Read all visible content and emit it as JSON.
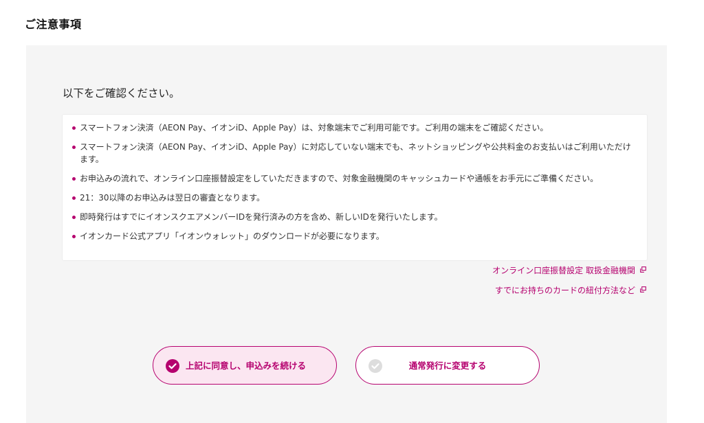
{
  "page": {
    "heading": "ご注意事項"
  },
  "notice": {
    "intro": "以下をご確認ください。",
    "items": [
      "スマートフォン決済（AEON Pay、イオンiD、Apple Pay）は、対象端末でご利用可能です。ご利用の端末をご確認ください。",
      "スマートフォン決済（AEON Pay、イオンiD、Apple Pay）に対応していない端末でも、ネットショッピングや公共料金のお支払いはご利用いただけます。",
      "お申込みの流れで、オンライン口座振替設定をしていただきますので、対象金融機関のキャッシュカードや通帳をお手元にご準備ください。",
      "21：30以降のお申込みは翌日の審査となります。",
      "即時発行はすでにイオンスクエアメンバーIDを発行済みの方を含め、新しいIDを発行いたします。",
      "イオンカード公式アプリ「イオンウォレット」のダウンロードが必要になります。"
    ]
  },
  "links": {
    "bank_list": "オンライン口座振替設定 取扱金融機関",
    "card_linking": "すでにお持ちのカードの紐付方法など"
  },
  "buttons": {
    "agree": "上記に同意し、申込みを続ける",
    "normal_issue": "通常発行に変更する"
  },
  "icons": {
    "external_link": "external-link-icon",
    "check_active": "check-circle-icon",
    "check_inactive": "check-circle-inactive-icon"
  },
  "colors": {
    "accent": "#b5006e",
    "accent_light": "#fbe6f1",
    "panel_bg": "#f5f5f5",
    "inactive_check": "#dddddd"
  }
}
